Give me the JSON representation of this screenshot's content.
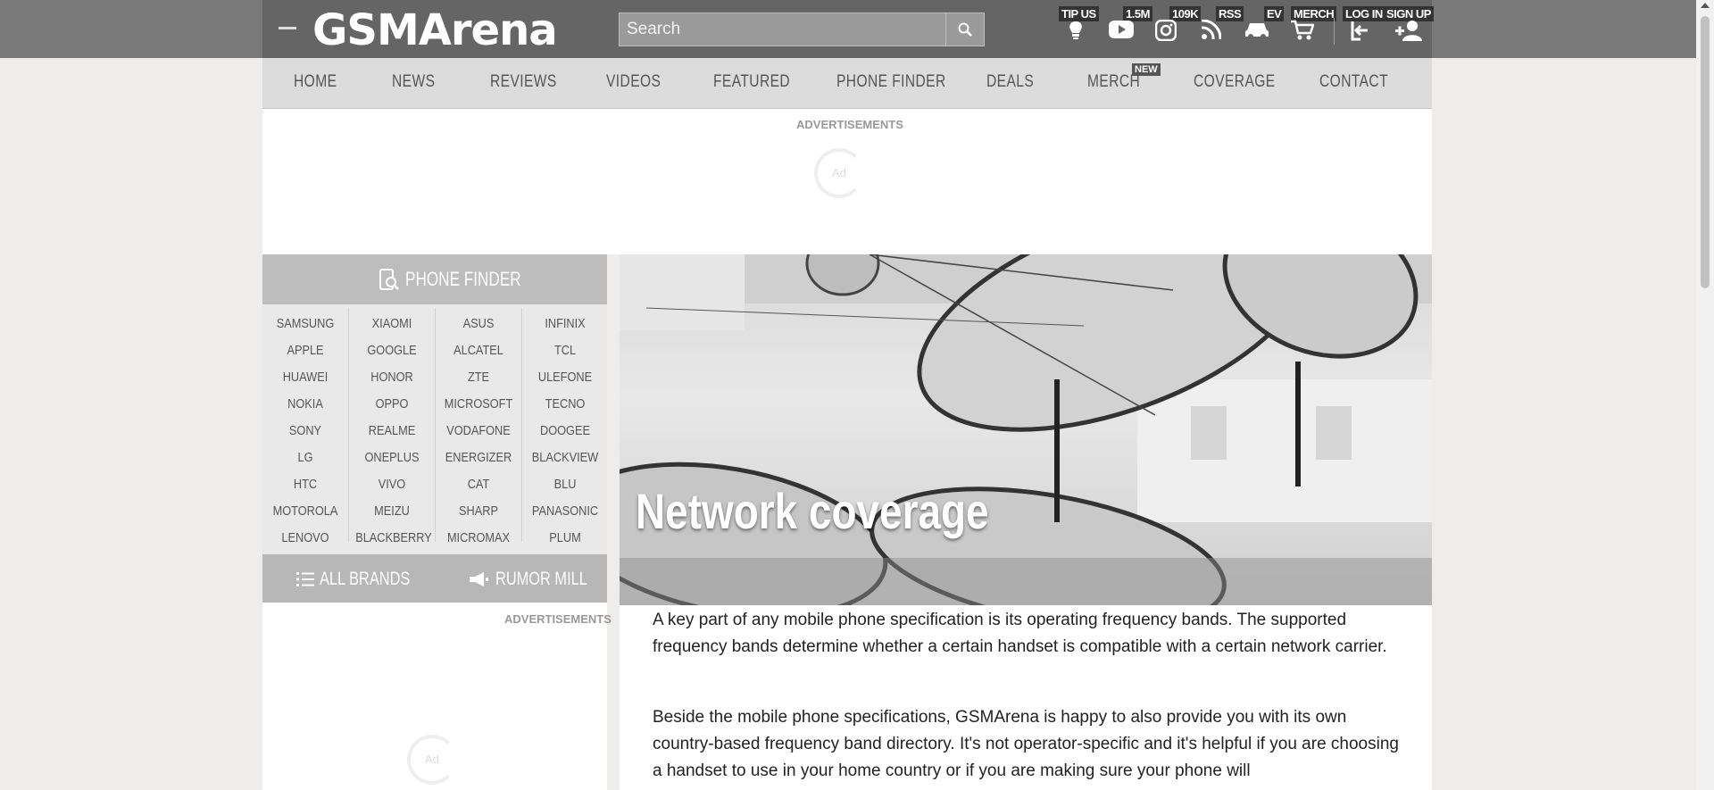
{
  "header": {
    "logo_text": "GSMArena",
    "search_placeholder": "Search",
    "tools": [
      {
        "label": "TIP US",
        "icon": "lightbulb-icon"
      },
      {
        "label": "1.5M",
        "icon": "youtube-icon"
      },
      {
        "label": "109K",
        "icon": "instagram-icon"
      },
      {
        "label": "RSS",
        "icon": "rss-icon"
      },
      {
        "label": "EV",
        "icon": "car-icon"
      },
      {
        "label": "MERCH",
        "icon": "cart-icon"
      },
      {
        "label": "LOG IN",
        "icon": "login-icon"
      },
      {
        "label": "SIGN UP",
        "icon": "add-user-icon"
      }
    ]
  },
  "nav": {
    "items": [
      "HOME",
      "NEWS",
      "REVIEWS",
      "VIDEOS",
      "FEATURED",
      "PHONE FINDER",
      "DEALS",
      "MERCH",
      "COVERAGE",
      "CONTACT"
    ],
    "new_badge": "NEW"
  },
  "ads": {
    "label": "ADVERTISEMENTS",
    "placeholder": "Ad"
  },
  "phone_finder": {
    "title": "PHONE FINDER",
    "columns": [
      [
        "SAMSUNG",
        "APPLE",
        "HUAWEI",
        "NOKIA",
        "SONY",
        "LG",
        "HTC",
        "MOTOROLA",
        "LENOVO"
      ],
      [
        "XIAOMI",
        "GOOGLE",
        "HONOR",
        "OPPO",
        "REALME",
        "ONEPLUS",
        "VIVO",
        "MEIZU",
        "BLACKBERRY"
      ],
      [
        "ASUS",
        "ALCATEL",
        "ZTE",
        "MICROSOFT",
        "VODAFONE",
        "ENERGIZER",
        "CAT",
        "SHARP",
        "MICROMAX"
      ],
      [
        "INFINIX",
        "TCL",
        "ULEFONE",
        "TECNO",
        "DOOGEE",
        "BLACKVIEW",
        "BLU",
        "PANASONIC",
        "PLUM"
      ]
    ],
    "all_brands": "ALL BRANDS",
    "rumor_mill": "RUMOR MILL"
  },
  "article": {
    "title": "Network coverage",
    "paragraphs": [
      "A key part of any mobile phone specification is its operating frequency bands. The supported frequency bands determine whether a certain handset is compatible with a certain network carrier.",
      "Beside the mobile phone specifications, GSMArena is happy to also provide you with its own country-based frequency band directory. It's not operator-specific and it's helpful if you are choosing a handset to use in your home country or if you are making sure your phone will"
    ]
  }
}
